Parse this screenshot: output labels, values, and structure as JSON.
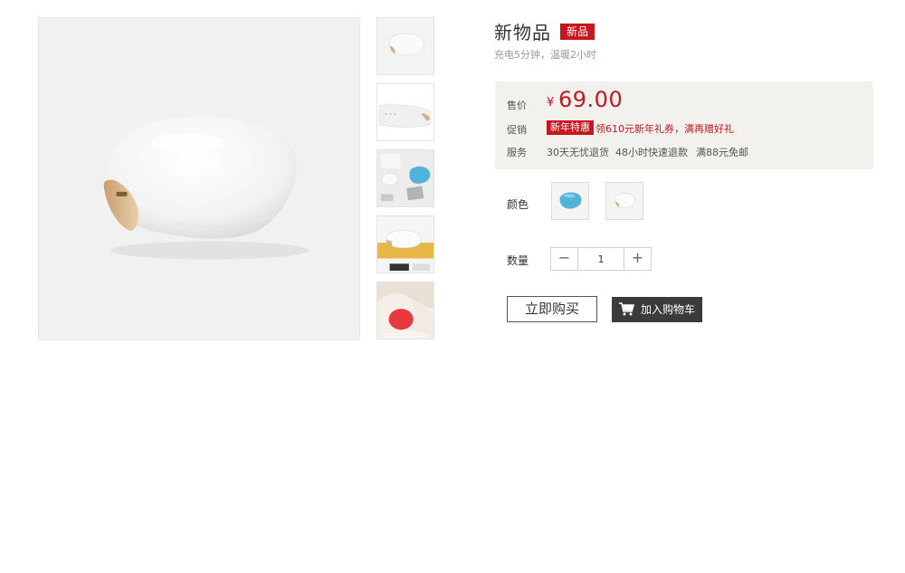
{
  "product": {
    "title": "新物品",
    "badge": "新品",
    "subtitle": "充电5分钟，温暖2小时"
  },
  "price_box": {
    "price_label": "售价",
    "currency": "¥",
    "price": "69.00",
    "promo_label": "促销",
    "promo_tag": "新年特惠",
    "promo_text": "领610元新年礼券，满再赠好礼",
    "service_label": "服务",
    "services": [
      "30天无忧退货",
      "48小时快速退款",
      "满88元免邮"
    ]
  },
  "options": {
    "color_label": "颜色",
    "colors": [
      "blue",
      "white"
    ],
    "quantity_label": "数量",
    "quantity": "1",
    "minus": "−",
    "plus": "+"
  },
  "actions": {
    "buy_now": "立即购买",
    "add_to_cart": "加入购物车"
  },
  "colors": {
    "accent_red": "#c9151e",
    "price_box_bg": "#f2f1ee",
    "cart_button_bg": "#3b3b3b"
  },
  "icons": {
    "cart": "cart-icon"
  }
}
